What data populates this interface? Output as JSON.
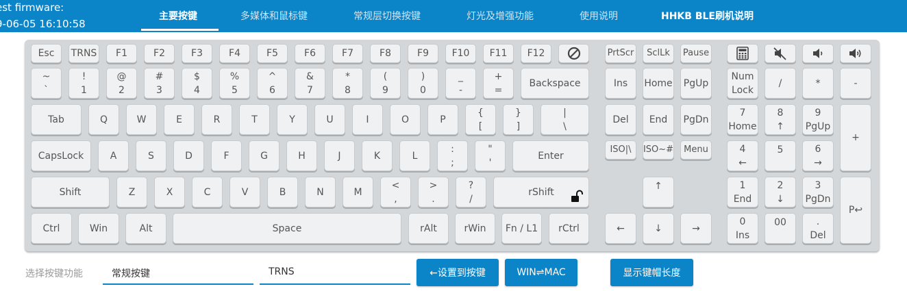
{
  "header": {
    "fw_label": "est firmware:",
    "fw_time": "9-06-05 16:10:58",
    "tabs": [
      {
        "label": "主要按键"
      },
      {
        "label": "多媒体和鼠标键"
      },
      {
        "label": "常规层切换按键"
      },
      {
        "label": "灯光及增强功能"
      },
      {
        "label": "使用说明"
      },
      {
        "label": "HHKB BLE刷机说明"
      }
    ]
  },
  "keys": {
    "esc": "Esc",
    "trns": "TRNS",
    "f1": "F1",
    "f2": "F2",
    "f3": "F3",
    "f4": "F4",
    "f5": "F5",
    "f6": "F6",
    "f7": "F7",
    "f8": "F8",
    "f9": "F9",
    "f10": "F10",
    "f11": "F11",
    "f12": "F12",
    "prtscr": "PrtScr",
    "scllk": "SclLk",
    "pause": "Pause",
    "grave_top": "~",
    "grave_bot": "`",
    "k1_top": "!",
    "k1_bot": "1",
    "k2_top": "@",
    "k2_bot": "2",
    "k3_top": "#",
    "k3_bot": "3",
    "k4_top": "$",
    "k4_bot": "4",
    "k5_top": "%",
    "k5_bot": "5",
    "k6_top": "^",
    "k6_bot": "6",
    "k7_top": "&",
    "k7_bot": "7",
    "k8_top": "*",
    "k8_bot": "8",
    "k9_top": "(",
    "k9_bot": "9",
    "k0_top": ")",
    "k0_bot": "0",
    "minus_top": "_",
    "minus_bot": "-",
    "equal_top": "+",
    "equal_bot": "=",
    "backspace": "Backspace",
    "ins": "Ins",
    "home": "Home",
    "pgup": "PgUp",
    "numlock_top": "Num",
    "numlock_bot": "Lock",
    "kp_div": "/",
    "kp_mul": "*",
    "kp_sub": "-",
    "tab": "Tab",
    "q": "Q",
    "w": "W",
    "e": "E",
    "r": "R",
    "t": "T",
    "y": "Y",
    "u": "U",
    "i": "I",
    "o": "O",
    "p": "P",
    "lbrace_top": "{",
    "lbrace_bot": "[",
    "rbrace_top": "}",
    "rbrace_bot": "]",
    "pipe_top": "|",
    "pipe_bot": "\\",
    "del": "Del",
    "end": "End",
    "pgdn": "PgDn",
    "kp7_top": "7",
    "kp7_bot": "Home",
    "kp8_top": "8",
    "kp8_bot": "↑",
    "kp9_top": "9",
    "kp9_bot": "PgUp",
    "kp_add": "+",
    "capslock": "CapsLock",
    "a": "A",
    "s": "S",
    "d": "D",
    "f": "F",
    "g": "G",
    "h": "H",
    "j": "J",
    "k": "K",
    "l": "L",
    "semi_top": ":",
    "semi_bot": ";",
    "quote_top": "\"",
    "quote_bot": "'",
    "enter": "Enter",
    "iso_pipe": "ISO|\\",
    "iso_hash": "ISO~#",
    "menu": "Menu",
    "kp4_top": "4",
    "kp4_bot": "←",
    "kp5": "5",
    "kp6_top": "6",
    "kp6_bot": "→",
    "shift": "Shift",
    "z": "Z",
    "x": "X",
    "c": "C",
    "v": "V",
    "b": "B",
    "n": "N",
    "m": "M",
    "comma_top": "<",
    "comma_bot": ",",
    "period_top": ">",
    "period_bot": ".",
    "slash_top": "?",
    "slash_bot": "/",
    "rshift": "rShift",
    "up": "↑",
    "kp1_top": "1",
    "kp1_bot": "End",
    "kp2_top": "2",
    "kp2_bot": "↓",
    "kp3_top": "3",
    "kp3_bot": "PgDn",
    "kp_enter": "P↩",
    "ctrl": "Ctrl",
    "win": "Win",
    "alt": "Alt",
    "space": "Space",
    "ralt": "rAlt",
    "rwin": "rWin",
    "fn": "Fn / L1",
    "rctrl": "rCtrl",
    "left": "←",
    "down": "↓",
    "right": "→",
    "kp0_top": "0",
    "kp0_bot": "Ins",
    "kp00": "00",
    "kpdot_top": ".",
    "kpdot_bot": "Del"
  },
  "icons": {
    "disabled": "no-entry-icon",
    "calculator": "calculator-icon",
    "mute": "mute-icon",
    "vol_down": "volume-down-icon",
    "vol_up": "volume-up-icon",
    "lock": "unlocked-padlock-icon"
  },
  "bottom": {
    "select_label": "选择按键功能",
    "category_value": "常规按键",
    "key_value": "TRNS",
    "set_button": "←设置到按键",
    "winmac_button": "WIN⇌MAC",
    "keycap_button": "显示键帽长度"
  },
  "colors": {
    "accent": "#0b84c8",
    "keyboard_bg": "#d3d7d9",
    "key_face": "#f0f1f2"
  }
}
